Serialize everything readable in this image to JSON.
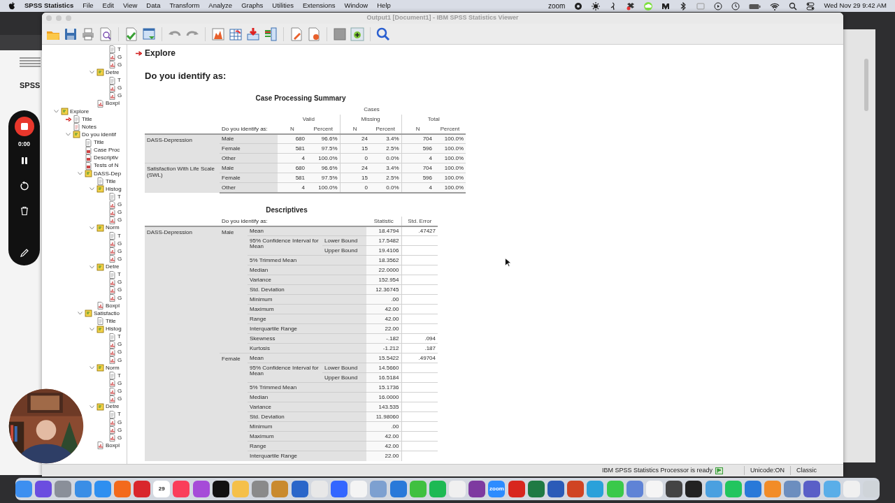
{
  "menu_bar": {
    "app_name": "SPSS Statistics",
    "menus": [
      "File",
      "Edit",
      "View",
      "Data",
      "Transform",
      "Analyze",
      "Graphs",
      "Utilities",
      "Extensions",
      "Window",
      "Help"
    ],
    "zoom_label": "zoom",
    "clock": "Wed Nov 29  9:42 AM"
  },
  "background_window": {
    "title": "SPSS"
  },
  "recorder": {
    "timer": "0:00"
  },
  "window": {
    "title": "Output1 [Document1] - IBM SPSS Statistics Viewer"
  },
  "tree": {
    "items": [
      {
        "children": [
          {
            "children": [
              {
                "children": [
                  {
                    "children": [
                      {
                        "kind": "title",
                        "label": "T",
                        "selected": false
                      },
                      {
                        "kind": "chart",
                        "label": "G",
                        "selected": false
                      },
                      {
                        "kind": "chart",
                        "label": "G",
                        "selected": false
                      }
                    ]
                  },
                  {
                    "kind": "heading",
                    "label": "Detre",
                    "expanded": true,
                    "selected": false,
                    "children": [
                      {
                        "kind": "title",
                        "label": "T",
                        "selected": false
                      },
                      {
                        "kind": "chart",
                        "label": "G",
                        "selected": false
                      },
                      {
                        "kind": "chart",
                        "label": "G",
                        "selected": false
                      }
                    ]
                  },
                  {
                    "kind": "chart",
                    "label": "Boxpl",
                    "selected": false
                  }
                ]
              }
            ]
          }
        ]
      },
      {
        "kind": "heading",
        "label": "Explore",
        "expanded": true,
        "selected": false,
        "children": [
          {
            "kind": "title",
            "label": "Title",
            "selected": true
          },
          {
            "kind": "notes",
            "label": "Notes",
            "selected": false
          },
          {
            "kind": "heading",
            "label": "Do you identif",
            "expanded": true,
            "selected": false,
            "children": [
              {
                "kind": "title",
                "label": "Title",
                "selected": false
              },
              {
                "kind": "table",
                "label": "Case Proc",
                "selected": false
              },
              {
                "kind": "table",
                "label": "Descriptiv",
                "selected": false
              },
              {
                "kind": "table",
                "label": "Tests of N",
                "selected": false
              },
              {
                "kind": "heading",
                "label": "DASS-Dep",
                "expanded": true,
                "selected": false,
                "children": [
                  {
                    "kind": "title",
                    "label": "Title",
                    "selected": false
                  },
                  {
                    "kind": "heading",
                    "label": "Histog",
                    "expanded": true,
                    "selected": false,
                    "children": [
                      {
                        "kind": "title",
                        "label": "T",
                        "selected": false
                      },
                      {
                        "kind": "chart",
                        "label": "G",
                        "selected": false
                      },
                      {
                        "kind": "chart",
                        "label": "G",
                        "selected": false
                      },
                      {
                        "kind": "chart",
                        "label": "G",
                        "selected": false
                      }
                    ]
                  },
                  {
                    "kind": "heading",
                    "label": "Norm",
                    "expanded": true,
                    "selected": false,
                    "children": [
                      {
                        "kind": "title",
                        "label": "T",
                        "selected": false
                      },
                      {
                        "kind": "chart",
                        "label": "G",
                        "selected": false
                      },
                      {
                        "kind": "chart",
                        "label": "G",
                        "selected": false
                      },
                      {
                        "kind": "chart",
                        "label": "G",
                        "selected": false
                      }
                    ]
                  },
                  {
                    "kind": "heading",
                    "label": "Detre",
                    "expanded": true,
                    "selected": false,
                    "children": [
                      {
                        "kind": "title",
                        "label": "T",
                        "selected": false
                      },
                      {
                        "kind": "chart",
                        "label": "G",
                        "selected": false
                      },
                      {
                        "kind": "chart",
                        "label": "G",
                        "selected": false
                      },
                      {
                        "kind": "chart",
                        "label": "G",
                        "selected": false
                      }
                    ]
                  },
                  {
                    "kind": "chart",
                    "label": "Boxpl",
                    "selected": false
                  }
                ]
              },
              {
                "kind": "heading",
                "label": "Satisfactio",
                "expanded": true,
                "selected": false,
                "children": [
                  {
                    "kind": "title",
                    "label": "Title",
                    "selected": false
                  },
                  {
                    "kind": "heading",
                    "label": "Histog",
                    "expanded": true,
                    "selected": false,
                    "children": [
                      {
                        "kind": "title",
                        "label": "T",
                        "selected": false
                      },
                      {
                        "kind": "chart",
                        "label": "G",
                        "selected": false
                      },
                      {
                        "kind": "chart",
                        "label": "G",
                        "selected": false
                      },
                      {
                        "kind": "chart",
                        "label": "G",
                        "selected": false
                      }
                    ]
                  },
                  {
                    "kind": "heading",
                    "label": "Norm",
                    "expanded": true,
                    "selected": false,
                    "children": [
                      {
                        "kind": "title",
                        "label": "T",
                        "selected": false
                      },
                      {
                        "kind": "chart",
                        "label": "G",
                        "selected": false
                      },
                      {
                        "kind": "chart",
                        "label": "G",
                        "selected": false
                      },
                      {
                        "kind": "chart",
                        "label": "G",
                        "selected": false
                      }
                    ]
                  },
                  {
                    "kind": "heading",
                    "label": "Detre",
                    "expanded": true,
                    "selected": false,
                    "children": [
                      {
                        "kind": "title",
                        "label": "T",
                        "selected": false
                      },
                      {
                        "kind": "chart",
                        "label": "G",
                        "selected": false
                      },
                      {
                        "kind": "chart",
                        "label": "G",
                        "selected": false
                      },
                      {
                        "kind": "chart",
                        "label": "G",
                        "selected": false
                      }
                    ]
                  },
                  {
                    "kind": "chart",
                    "label": "Boxpl",
                    "selected": false
                  }
                ]
              }
            ]
          }
        ]
      }
    ]
  },
  "output": {
    "heading": "Explore",
    "subheading": "Do you identify as:",
    "case_summary": {
      "title": "Case Processing Summary",
      "top_header": "Cases",
      "group_headers": [
        "Valid",
        "Missing",
        "Total"
      ],
      "identify_header": "Do you identify as:",
      "sub_headers": [
        "N",
        "Percent",
        "N",
        "Percent",
        "N",
        "Percent"
      ],
      "variables": [
        {
          "name": "DASS-Depression",
          "rows": [
            {
              "category": "Male",
              "values": [
                "680",
                "96.6%",
                "24",
                "3.4%",
                "704",
                "100.0%"
              ]
            },
            {
              "category": "Female",
              "values": [
                "581",
                "97.5%",
                "15",
                "2.5%",
                "596",
                "100.0%"
              ]
            },
            {
              "category": "Other",
              "values": [
                "4",
                "100.0%",
                "0",
                "0.0%",
                "4",
                "100.0%"
              ]
            }
          ]
        },
        {
          "name": "Satisfaction With Life Scale (SWL)",
          "rows": [
            {
              "category": "Male",
              "values": [
                "680",
                "96.6%",
                "24",
                "3.4%",
                "704",
                "100.0%"
              ]
            },
            {
              "category": "Female",
              "values": [
                "581",
                "97.5%",
                "15",
                "2.5%",
                "596",
                "100.0%"
              ]
            },
            {
              "category": "Other",
              "values": [
                "4",
                "100.0%",
                "0",
                "0.0%",
                "4",
                "100.0%"
              ]
            }
          ]
        }
      ]
    },
    "descriptives": {
      "title": "Descriptives",
      "identify_header": "Do you identify as:",
      "columns": [
        "Statistic",
        "Std. Error"
      ],
      "variables": [
        {
          "name": "DASS-Depression",
          "groups": [
            {
              "category": "Male",
              "rows": [
                {
                  "stat": "Mean",
                  "statistic": "18.4794",
                  "std_error": ".47427"
                },
                {
                  "stat": "95% Confidence Interval for Mean",
                  "bounds": [
                    {
                      "label": "Lower Bound",
                      "statistic": "17.5482"
                    },
                    {
                      "label": "Upper Bound",
                      "statistic": "19.4106"
                    }
                  ]
                },
                {
                  "stat": "5% Trimmed Mean",
                  "statistic": "18.3562"
                },
                {
                  "stat": "Median",
                  "statistic": "22.0000"
                },
                {
                  "stat": "Variance",
                  "statistic": "152.954"
                },
                {
                  "stat": "Std. Deviation",
                  "statistic": "12.36745"
                },
                {
                  "stat": "Minimum",
                  "statistic": ".00"
                },
                {
                  "stat": "Maximum",
                  "statistic": "42.00"
                },
                {
                  "stat": "Range",
                  "statistic": "42.00"
                },
                {
                  "stat": "Interquartile Range",
                  "statistic": "22.00"
                },
                {
                  "stat": "Skewness",
                  "statistic": "-.182",
                  "std_error": ".094"
                },
                {
                  "stat": "Kurtosis",
                  "statistic": "-1.212",
                  "std_error": ".187"
                }
              ]
            },
            {
              "category": "Female",
              "rows": [
                {
                  "stat": "Mean",
                  "statistic": "15.5422",
                  "std_error": ".49704"
                },
                {
                  "stat": "95% Confidence Interval for Mean",
                  "bounds": [
                    {
                      "label": "Lower Bound",
                      "statistic": "14.5660"
                    },
                    {
                      "label": "Upper Bound",
                      "statistic": "16.5184"
                    }
                  ]
                },
                {
                  "stat": "5% Trimmed Mean",
                  "statistic": "15.1736"
                },
                {
                  "stat": "Median",
                  "statistic": "16.0000"
                },
                {
                  "stat": "Variance",
                  "statistic": "143.535"
                },
                {
                  "stat": "Std. Deviation",
                  "statistic": "11.98060"
                },
                {
                  "stat": "Minimum",
                  "statistic": ".00"
                },
                {
                  "stat": "Maximum",
                  "statistic": "42.00"
                },
                {
                  "stat": "Range",
                  "statistic": "42.00"
                },
                {
                  "stat": "Interquartile Range",
                  "statistic": "22.00"
                }
              ]
            }
          ]
        }
      ]
    }
  },
  "status_bar": {
    "message": "IBM SPSS Statistics Processor is ready",
    "unicode": "Unicode:ON",
    "mode": "Classic"
  },
  "dock": {
    "apps": [
      {
        "color": "#3d8ff0"
      },
      {
        "color": "#6b4de0"
      },
      {
        "color": "#8a8f99"
      },
      {
        "color": "#3a8ee6"
      },
      {
        "color": "#2e8ff0"
      },
      {
        "color": "#f36a1c"
      },
      {
        "color": "#d9262c"
      },
      {
        "color": "#ffffff",
        "label": "29"
      },
      {
        "color": "#fa3e5a"
      },
      {
        "color": "#a64bd8"
      },
      {
        "color": "#111111"
      },
      {
        "color": "#f5c04a"
      },
      {
        "color": "#8a8a8a"
      },
      {
        "color": "#c98a2e"
      },
      {
        "color": "#2a66c9"
      },
      {
        "color": "#e8e8e8"
      },
      {
        "color": "#3366ff"
      },
      {
        "color": "#f4f4f4"
      },
      {
        "color": "#7da0d0"
      },
      {
        "color": "#2979d9"
      },
      {
        "color": "#40c040"
      },
      {
        "color": "#1db954"
      },
      {
        "color": "#f0f0f0"
      },
      {
        "color": "#7e3aa0"
      },
      {
        "color": "#2d8cff",
        "label": "zoom"
      },
      {
        "color": "#d8261e"
      },
      {
        "color": "#1f7a44"
      },
      {
        "color": "#2b5bb8"
      },
      {
        "color": "#d04423"
      },
      {
        "color": "#2aa1da"
      },
      {
        "color": "#3ac94a"
      },
      {
        "color": "#5f83d6"
      },
      {
        "color": "#f5f5f5"
      },
      {
        "color": "#444444"
      },
      {
        "color": "#222222"
      },
      {
        "color": "#4aa0e0"
      },
      {
        "color": "#22c55e"
      },
      {
        "color": "#2979d9"
      },
      {
        "color": "#f28c28"
      },
      {
        "color": "#6c8ebf"
      },
      {
        "color": "#5a5fc7"
      },
      {
        "color": "#5aaee8"
      },
      {
        "color": "#f0f0f0"
      },
      {
        "color": "#cfd4d9"
      }
    ]
  }
}
